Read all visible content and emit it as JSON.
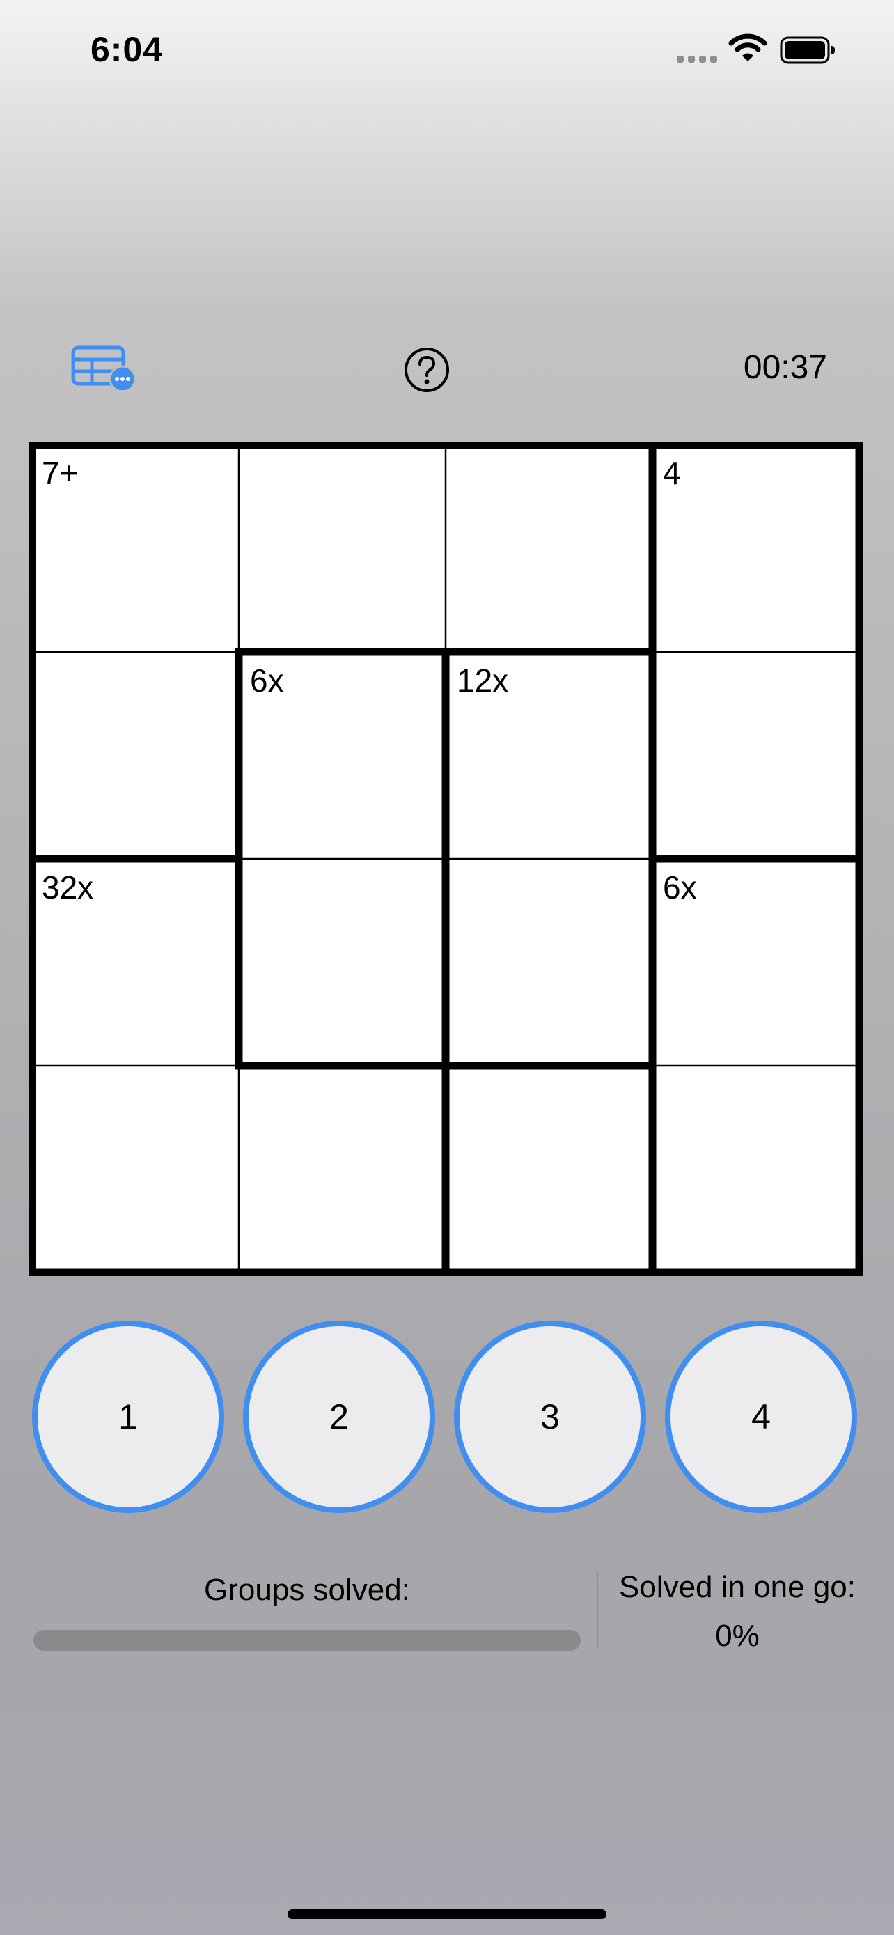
{
  "status_bar": {
    "time": "6:04"
  },
  "toolbar": {
    "menu_icon": "table-options-icon",
    "help_icon": "question-circle-icon",
    "timer": "00:37"
  },
  "colors": {
    "accent": "#3f8ef0",
    "cell_background": "#ffffff",
    "button_fill": "#ececee"
  },
  "puzzle": {
    "size": 4,
    "clues": [
      {
        "label": "7+",
        "row": 0,
        "col": 0
      },
      {
        "label": "4",
        "row": 0,
        "col": 3
      },
      {
        "label": "6x",
        "row": 1,
        "col": 1
      },
      {
        "label": "12x",
        "row": 1,
        "col": 2
      },
      {
        "label": "32x",
        "row": 2,
        "col": 0
      },
      {
        "label": "6x",
        "row": 2,
        "col": 3
      }
    ],
    "cages": [
      [
        0,
        0,
        0,
        1
      ],
      [
        0,
        2,
        3,
        1
      ],
      [
        4,
        2,
        3,
        5
      ],
      [
        4,
        4,
        6,
        5
      ]
    ]
  },
  "number_pad": [
    "1",
    "2",
    "3",
    "4"
  ],
  "stats": {
    "groups_label": "Groups solved:",
    "groups_progress": 0,
    "one_go_label": "Solved in one go:",
    "one_go_value": "0%"
  }
}
